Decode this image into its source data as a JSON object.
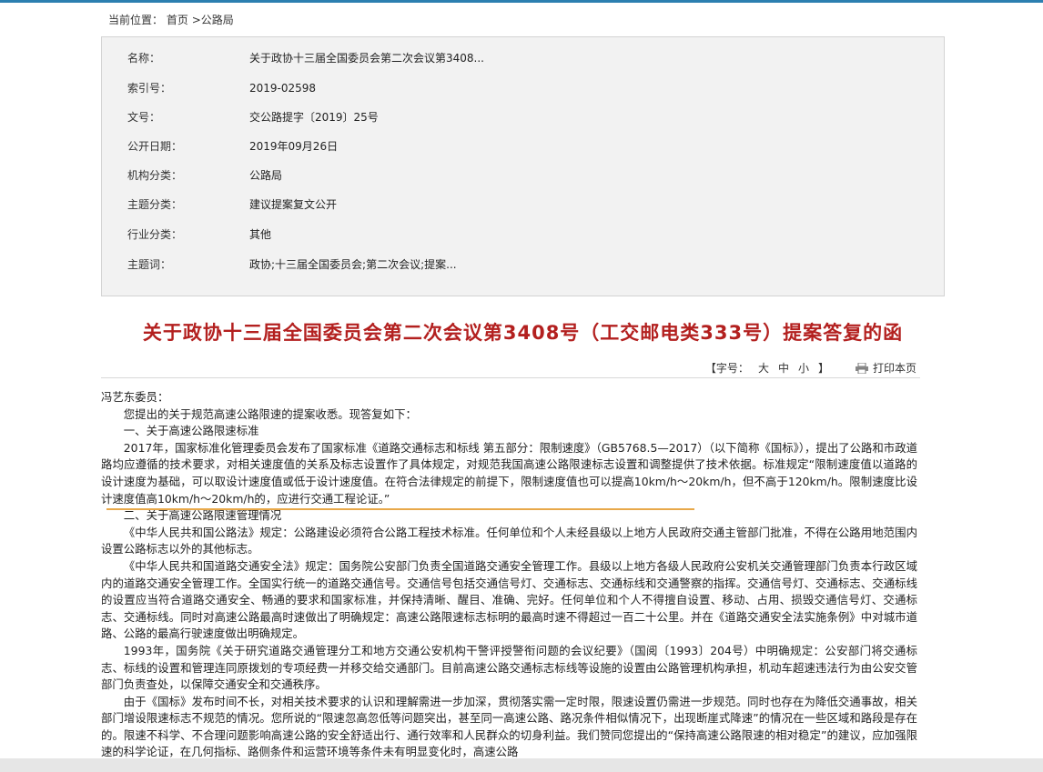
{
  "breadcrumb": {
    "prefix": "当前位置：",
    "home": "首页",
    "sep": ">",
    "current": "公路局"
  },
  "meta": [
    {
      "label": "名称：",
      "value": "关于政协十三届全国委员会第二次会议第3408..."
    },
    {
      "label": "索引号：",
      "value": "2019-02598"
    },
    {
      "label": "文号：",
      "value": "交公路提字〔2019〕25号"
    },
    {
      "label": "公开日期：",
      "value": "2019年09月26日"
    },
    {
      "label": "机构分类：",
      "value": "公路局"
    },
    {
      "label": "主题分类：",
      "value": "建议提案复文公开"
    },
    {
      "label": "行业分类：",
      "value": "其他"
    },
    {
      "label": "主题词：",
      "value": "政协;十三届全国委员会;第二次会议;提案..."
    }
  ],
  "title": "关于政协十三届全国委员会第二次会议第3408号（工交邮电类333号）提案答复的函",
  "toolbar": {
    "fontsize_label": "【字号：",
    "size_large": "大",
    "size_medium": "中",
    "size_small": "小",
    "fontsize_close": "】",
    "print_label": "打印本页"
  },
  "body": [
    {
      "indent": false,
      "text": "冯艺东委员："
    },
    {
      "indent": true,
      "text": "您提出的关于规范高速公路限速的提案收悉。现答复如下："
    },
    {
      "indent": true,
      "text": "一、关于高速公路限速标准"
    },
    {
      "indent": true,
      "text": "2017年，国家标准化管理委员会发布了国家标准《道路交通标志和标线 第五部分：限制速度》（GB5768.5—2017）（以下简称《国标》），提出了公路和市政道路均应遵循的技术要求，对相关速度值的关系及标志设置作了具体规定，对规范我国高速公路限速标志设置和调整提供了技术依据。标准规定“限制速度值以道路的设计速度为基础，可以取设计速度值或低于设计速度值。在符合法律规定的前提下，限制速度值也可以提高10km/h～20km/h，但不高于120km/h。限制速度比设计速度值高10km/h～20km/h的，应进行交通工程论证。”"
    },
    {
      "indent": true,
      "text": "二、关于高速公路限速管理情况"
    },
    {
      "indent": true,
      "text": "《中华人民共和国公路法》规定：公路建设必须符合公路工程技术标准。任何单位和个人未经县级以上地方人民政府交通主管部门批准，不得在公路用地范围内设置公路标志以外的其他标志。"
    },
    {
      "indent": true,
      "text": "《中华人民共和国道路交通安全法》规定：国务院公安部门负责全国道路交通安全管理工作。县级以上地方各级人民政府公安机关交通管理部门负责本行政区域内的道路交通安全管理工作。全国实行统一的道路交通信号。交通信号包括交通信号灯、交通标志、交通标线和交通警察的指挥。交通信号灯、交通标志、交通标线的设置应当符合道路交通安全、畅通的要求和国家标准，并保持清晰、醒目、准确、完好。任何单位和个人不得擅自设置、移动、占用、损毁交通信号灯、交通标志、交通标线。同时对高速公路最高时速做出了明确规定：高速公路限速标志标明的最高时速不得超过一百二十公里。并在《道路交通安全法实施条例》中对城市道路、公路的最高行驶速度做出明确规定。"
    },
    {
      "indent": true,
      "text": "1993年，国务院《关于研究道路交通管理分工和地方交通公安机构干警评授警衔问题的会议纪要》（国阅〔1993〕204号）中明确规定：公安部门将交通标志、标线的设置和管理连同原拨划的专项经费一并移交给交通部门。目前高速公路交通标志标线等设施的设置由公路管理机构承担，机动车超速违法行为由公安交管部门负责查处，以保障交通安全和交通秩序。"
    },
    {
      "indent": true,
      "text": "由于《国标》发布时间不长，对相关技术要求的认识和理解需进一步加深，贯彻落实需一定时限，限速设置仍需进一步规范。同时也存在为降低交通事故，相关部门增设限速标志不规范的情况。您所说的“限速忽高忽低等问题突出，甚至同一高速公路、路况条件相似情况下，出现断崖式降速”的情况在一些区域和路段是存在的。限速不科学、不合理问题影响高速公路的安全舒适出行、通行效率和人民群众的切身利益。我们赞同您提出的“保持高速公路限速的相对稳定”的建议，应加强限速的科学论证，在几何指标、路侧条件和运营环境等条件未有明显变化时，高速公路"
    }
  ]
}
